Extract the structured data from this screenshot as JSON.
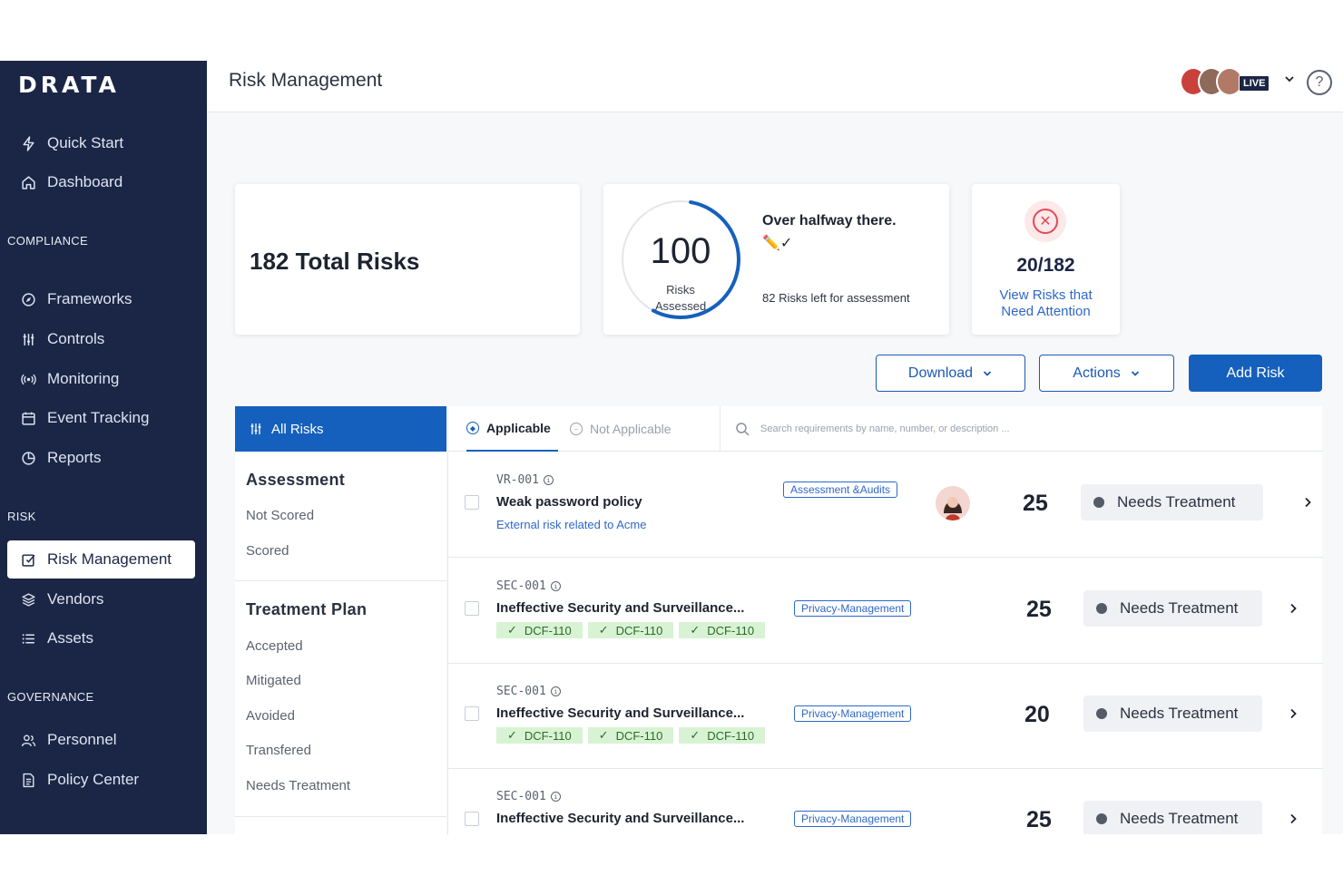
{
  "sidebar": {
    "logo": "DRATA",
    "quick_start": "Quick Start",
    "dashboard": "Dashboard",
    "section_compliance": "COMPLIANCE",
    "frameworks": "Frameworks",
    "controls": "Controls",
    "monitoring": "Monitoring",
    "event_tracking": "Event Tracking",
    "reports": "Reports",
    "section_risk": "RISK",
    "risk_management": "Risk Management",
    "vendors": "Vendors",
    "assets": "Assets",
    "section_governance": "GOVERNANCE",
    "personnel": "Personnel",
    "policy_center": "Policy Center"
  },
  "header": {
    "title": "Risk Management",
    "live_badge": "LIVE",
    "help": "?"
  },
  "summary": {
    "total_risks": "182 Total Risks",
    "assessed_count": "100",
    "assessed_label_1": "Risks",
    "assessed_label_2": "Assessed",
    "assessed_fraction": 0.55,
    "progress_heading": "Over halfway there.",
    "progress_emoji": "✏️✓",
    "progress_sub": "82 Risks left for assessment",
    "attention_count": "20/182",
    "attention_link_1": "View Risks that",
    "attention_link_2": "Need Attention"
  },
  "toolbar": {
    "download": "Download",
    "actions": "Actions",
    "add_risk": "Add Risk"
  },
  "filters": {
    "all_risks": "All Risks",
    "assessment_heading": "Assessment",
    "not_scored": "Not Scored",
    "scored": "Scored",
    "treatment_heading": "Treatment Plan",
    "accepted": "Accepted",
    "mitigated": "Mitigated",
    "avoided": "Avoided",
    "transfered": "Transfered",
    "needs_treatment": "Needs Treatment"
  },
  "table": {
    "tab_applicable": "Applicable",
    "tab_not_applicable": "Not Applicable",
    "search_placeholder": "Search requirements by name, number, or description ..."
  },
  "rows": [
    {
      "code": "VR-001",
      "title": "Weak password policy",
      "desc": "External risk related to Acme",
      "tag": "Assessment &Audits",
      "score": "25",
      "status": "Needs Treatment"
    },
    {
      "code": "SEC-001",
      "title": "Ineffective Security and Surveillance...",
      "chips": [
        "DCF-110",
        "DCF-110",
        "DCF-110"
      ],
      "tag": "Privacy-Management",
      "score": "25",
      "status": "Needs Treatment"
    },
    {
      "code": "SEC-001",
      "title": "Ineffective Security and Surveillance...",
      "chips": [
        "DCF-110",
        "DCF-110",
        "DCF-110"
      ],
      "tag": "Privacy-Management",
      "score": "20",
      "status": "Needs Treatment"
    },
    {
      "code": "SEC-001",
      "title": "Ineffective Security and Surveillance...",
      "tag": "Privacy-Management",
      "score": "25",
      "status": "Needs Treatment"
    }
  ],
  "colors": {
    "sidebar_bg": "#1b2646",
    "primary": "#1560bd",
    "link": "#2f68c9",
    "chip_bg": "#d8f3d3",
    "danger": "#e24b55"
  }
}
